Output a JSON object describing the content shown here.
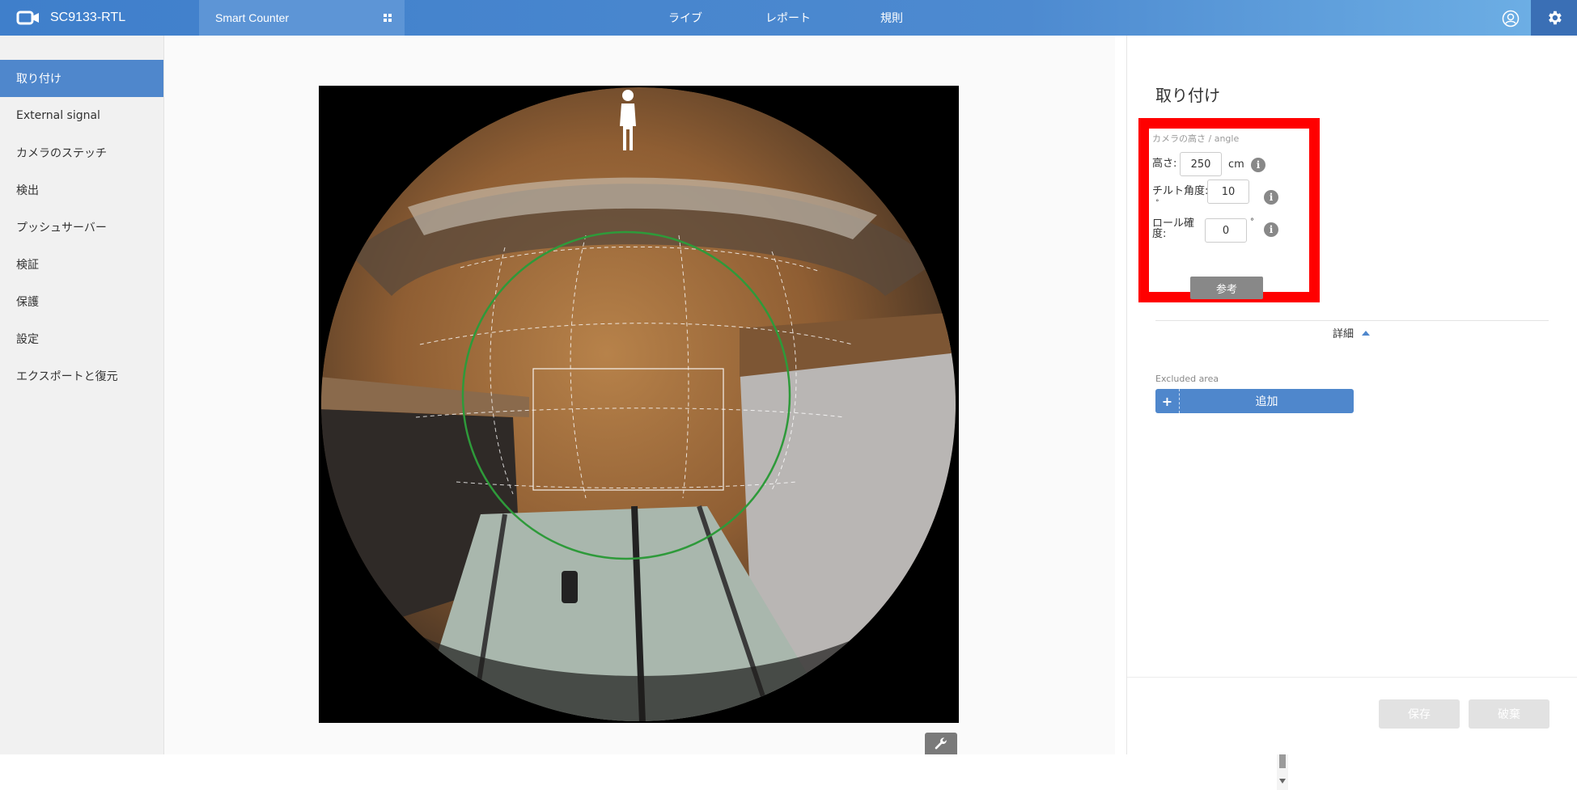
{
  "header": {
    "model": "SC9133-RTL",
    "app_name": "Smart Counter",
    "nav": [
      "ライブ",
      "レポート",
      "規則"
    ],
    "logo_icon": "vivotek-logo-icon",
    "user_icon": "user-account-icon",
    "settings_icon": "gear-icon"
  },
  "sidebar": {
    "items": [
      {
        "label": "取り付け",
        "active": true
      },
      {
        "label": "External signal",
        "active": false
      },
      {
        "label": "カメラのステッチ",
        "active": false
      },
      {
        "label": "検出",
        "active": false
      },
      {
        "label": "プッシュサーバー",
        "active": false
      },
      {
        "label": "検証",
        "active": false
      },
      {
        "label": "保護",
        "active": false
      },
      {
        "label": "設定",
        "active": false
      },
      {
        "label": "エクスポートと復元",
        "active": false
      }
    ]
  },
  "panel": {
    "title": "取り付け",
    "section_label": "カメラの高さ / angle",
    "height_label": "高さ:",
    "height_value": "250",
    "height_unit": "cm",
    "tilt_label": "チルト角度:",
    "tilt_subunit": "°",
    "tilt_value": "10",
    "roll_label_line1": "ロール確",
    "roll_label_line2": "度:",
    "roll_value": "0",
    "roll_unit": "°",
    "info_glyph": "i",
    "reference_button": "参考",
    "details_label": "詳細",
    "excluded_area_label": "Excluded area",
    "add_plus": "+",
    "add_button": "追加",
    "save_button": "保存",
    "discard_button": "破棄"
  },
  "colors": {
    "accent": "#4f87cc",
    "highlight_box": "#ff0000",
    "detection_circle": "#2e9a3a"
  }
}
